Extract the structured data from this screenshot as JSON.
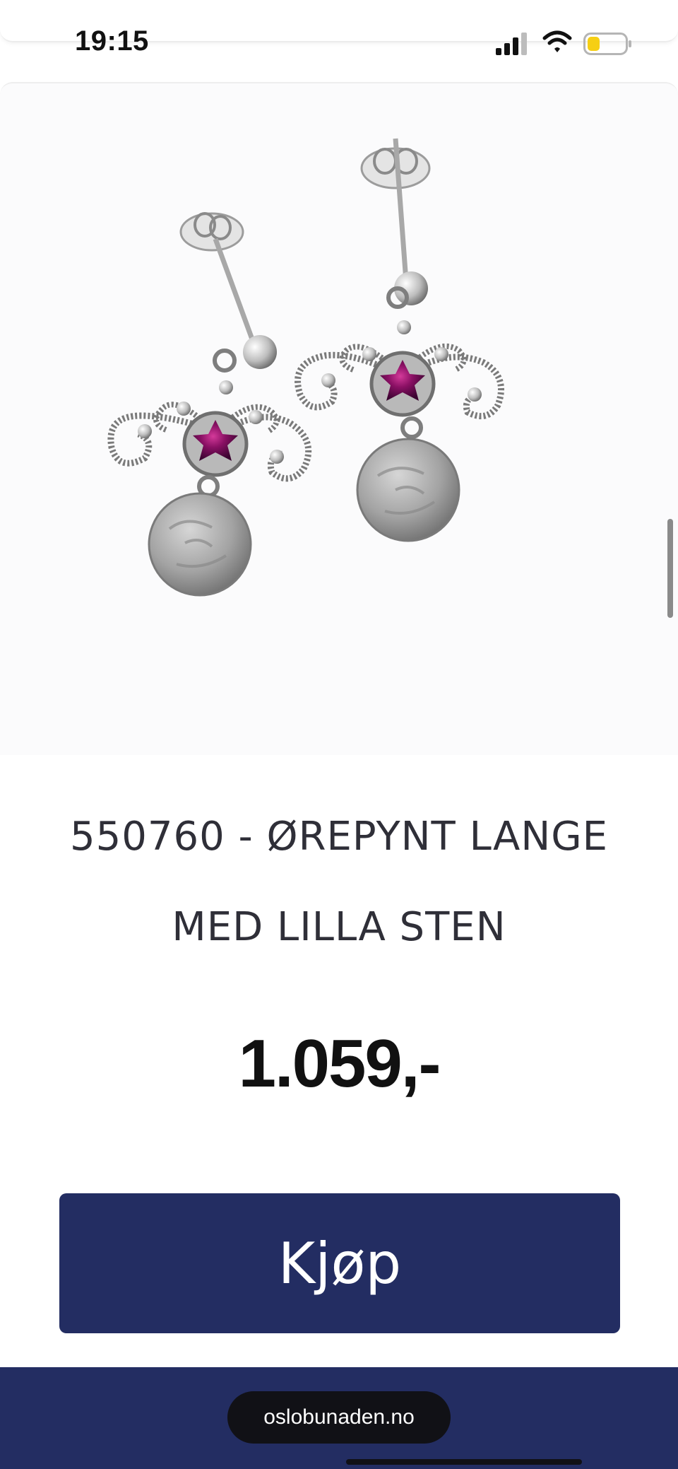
{
  "status_bar": {
    "time": "19:15",
    "icons": [
      "signal-icon",
      "wifi-icon",
      "battery-icon"
    ],
    "battery_color": "#f6cf14"
  },
  "product": {
    "image_alt": "earrings-with-purple-stone",
    "title_line1": "550760 - ØREPYNT LANGE",
    "title_line2": "MED LILLA STEN",
    "price": "1.059,-",
    "buy_label": "Kjøp"
  },
  "browser": {
    "url": "oslobunaden.no"
  },
  "colors": {
    "brand_navy": "#232d62",
    "stone_purple": "#7a0f5a"
  }
}
